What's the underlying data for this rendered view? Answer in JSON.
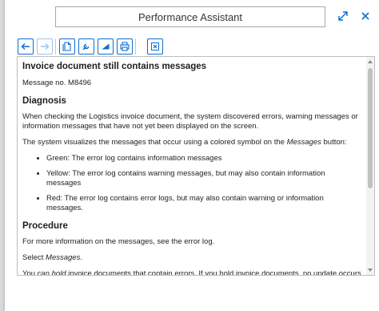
{
  "dialog": {
    "title": "Performance Assistant",
    "icons": {
      "resize": "resize-icon",
      "close": "close-icon"
    }
  },
  "toolbar": {
    "icons": [
      "arrow-left-icon",
      "arrow-right-icon",
      "document-icon",
      "wrench-icon",
      "flag-icon",
      "print-icon",
      "close-box-icon"
    ]
  },
  "content": {
    "title": "Invoice document still contains messages",
    "message_no": "Message no. M8496",
    "diagnosis_heading": "Diagnosis",
    "diagnosis_p1": "When checking the Logistics invoice document, the system discovered errors, warning messages or information messages that have not yet been displayed on the screen.",
    "diagnosis_p2_before": "The system visualizes the messages that occur using a colored symbol on the ",
    "diagnosis_p2_em": "Messages",
    "diagnosis_p2_after": " button:",
    "bullets": [
      "Green: The error log contains information messages",
      "Yellow: The error log contains warning messages, but may also contain information messages",
      "Red: The error log contains error logs, but may also contain warning or information messages."
    ],
    "procedure_heading": "Procedure",
    "procedure_p1": "For more information on the messages, see the error log.",
    "procedure_p2_before": "Select ",
    "procedure_p2_em": "Messages",
    "procedure_p2_after": ".",
    "procedure_p3_before": "You can ",
    "procedure_p3_em": "hold",
    "procedure_p3_after": " invoice documents that contain errors. If you hold invoice documents, no update occurs in Financial Accounting and the system takes no further action, such as creating a letter of complaint"
  },
  "colors": {
    "accent": "#0a6ed1",
    "text": "#1f1f1f",
    "border": "#bfbfbf"
  }
}
